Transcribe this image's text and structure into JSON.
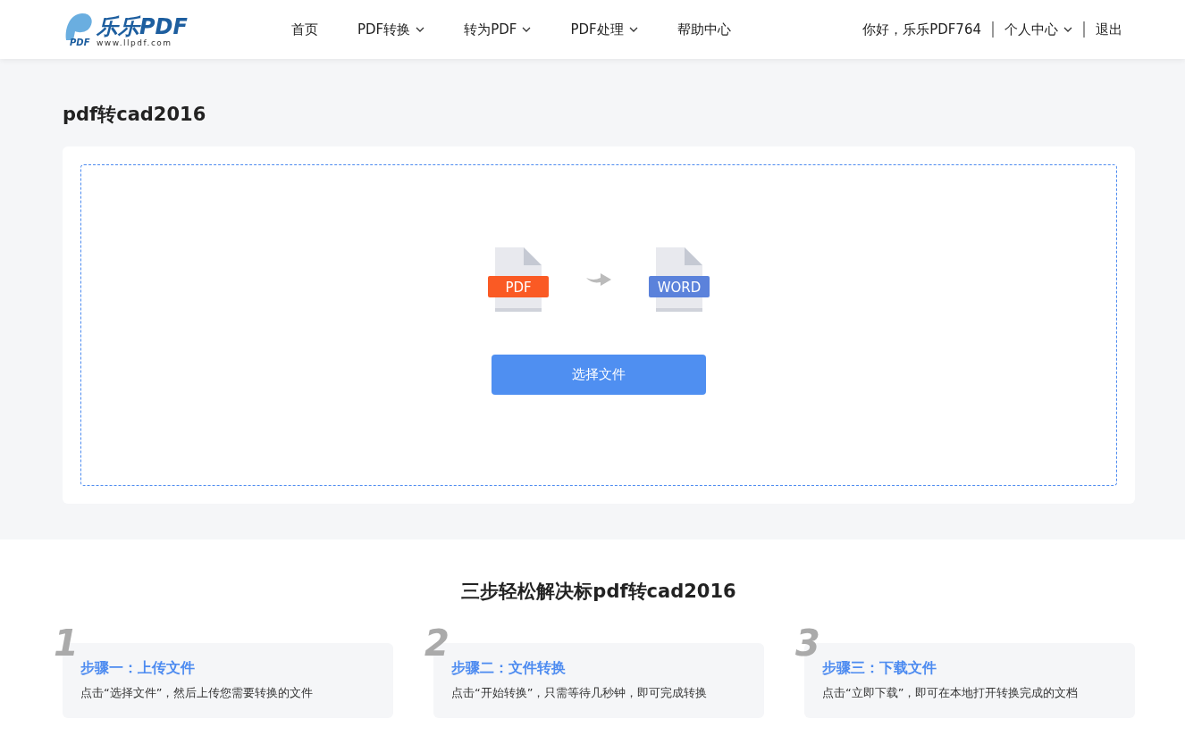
{
  "header": {
    "logo": {
      "mark": "PDF",
      "name": "乐乐PDF",
      "url": "www.llpdf.com"
    },
    "nav": [
      {
        "label": "首页",
        "has_menu": false
      },
      {
        "label": "PDF转换",
        "has_menu": true
      },
      {
        "label": "转为PDF",
        "has_menu": true
      },
      {
        "label": "PDF处理",
        "has_menu": true
      },
      {
        "label": "帮助中心",
        "has_menu": false
      }
    ],
    "greeting": "你好，乐乐PDF764",
    "account": {
      "label": "个人中心",
      "has_menu": true
    },
    "logout": "退出"
  },
  "page_title": "pdf转cad2016",
  "upload": {
    "from_label": "PDF",
    "to_label": "WORD",
    "button": "选择文件"
  },
  "steps_title": "三步轻松解决标pdf转cad2016",
  "steps": [
    {
      "number": "1",
      "title": "步骤一：上传文件",
      "text": "点击“选择文件”，然后上传您需要转换的文件"
    },
    {
      "number": "2",
      "title": "步骤二：文件转换",
      "text": "点击“开始转换”，只需等待几秒钟，即可完成转换"
    },
    {
      "number": "3",
      "title": "步骤三：下载文件",
      "text": "点击“立即下载”，即可在本地打开转换完成的文档"
    }
  ]
}
